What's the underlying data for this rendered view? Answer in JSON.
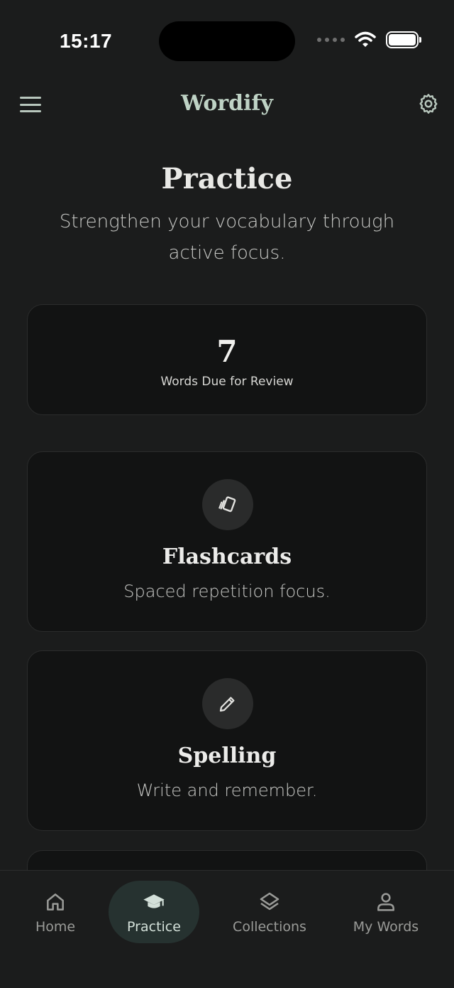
{
  "status_bar": {
    "time": "15:17"
  },
  "header": {
    "app_title": "Wordify"
  },
  "page": {
    "title": "Practice",
    "subtitle": "Strengthen your vocabulary through active focus."
  },
  "review": {
    "count": "7",
    "label": "Words Due for Review"
  },
  "modes": [
    {
      "title": "Flashcards",
      "description": "Spaced repetition focus.",
      "icon": "cards-icon"
    },
    {
      "title": "Spelling",
      "description": "Write and remember.",
      "icon": "pencil-icon"
    }
  ],
  "nav": {
    "items": [
      {
        "label": "Home",
        "icon": "home-icon"
      },
      {
        "label": "Practice",
        "icon": "graduation-cap-icon",
        "active": true
      },
      {
        "label": "Collections",
        "icon": "layers-icon"
      },
      {
        "label": "My Words",
        "icon": "user-icon"
      }
    ]
  },
  "colors": {
    "background": "#1b1c1c",
    "card": "#121313",
    "accent": "#bfd3c5",
    "active_nav": "#263230"
  }
}
